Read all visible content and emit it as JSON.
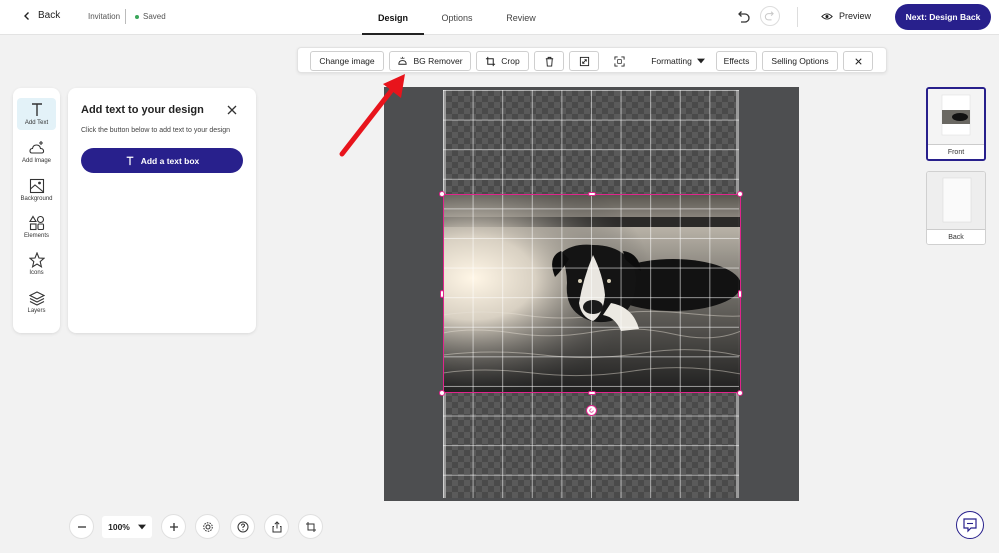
{
  "header": {
    "back_label": "Back",
    "doc_name": "Invitation",
    "save_status": "Saved",
    "tabs": [
      {
        "label": "Design",
        "active": true
      },
      {
        "label": "Options",
        "active": false
      },
      {
        "label": "Review",
        "active": false
      }
    ],
    "preview_label": "Preview",
    "next_label": "Next: Design Back"
  },
  "toolbar": {
    "change_image": "Change image",
    "bg_remover": "BG Remover",
    "crop": "Crop",
    "formatting": "Formatting",
    "effects": "Effects",
    "selling_options": "Selling Options"
  },
  "rail": {
    "items": [
      {
        "label": "Add Text",
        "icon": "text-icon",
        "active": true
      },
      {
        "label": "Add Image",
        "icon": "add-image-icon",
        "active": false
      },
      {
        "label": "Background",
        "icon": "background-icon",
        "active": false
      },
      {
        "label": "Elements",
        "icon": "elements-icon",
        "active": false
      },
      {
        "label": "Icons",
        "icon": "star-icon",
        "active": false
      },
      {
        "label": "Layers",
        "icon": "layers-icon",
        "active": false
      }
    ]
  },
  "panel": {
    "title": "Add text to your design",
    "description": "Click the button below to add text to your design",
    "button_label": "Add a text box"
  },
  "pages": [
    {
      "label": "Front",
      "active": true
    },
    {
      "label": "Back",
      "active": false
    }
  ],
  "zoom": {
    "value": "100%"
  },
  "colors": {
    "brand": "#28208c",
    "selection": "#e0258c",
    "annotation_arrow": "#e8141c",
    "canvas_bg": "#4d4e50"
  }
}
